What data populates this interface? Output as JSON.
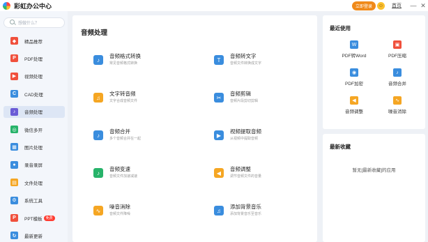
{
  "titlebar": {
    "app_title": "彩虹办公中心",
    "login_label": "立即登录",
    "home_label": "首页",
    "minimize": "—",
    "close": "✕"
  },
  "sidebar": {
    "search_placeholder": "想做什么？",
    "items": [
      {
        "label": "精品推荐",
        "icon": "gift-icon",
        "color": "#f0503c",
        "active": false
      },
      {
        "label": "PDF处理",
        "icon": "pdf-icon",
        "color": "#f0503c",
        "active": false
      },
      {
        "label": "视频处理",
        "icon": "video-icon",
        "color": "#f0503c",
        "active": false
      },
      {
        "label": "CAD处理",
        "icon": "cad-icon",
        "color": "#3a8dde",
        "active": false
      },
      {
        "label": "音频处理",
        "icon": "music-icon",
        "color": "#6a5bd6",
        "active": true
      },
      {
        "label": "微信多开",
        "icon": "wechat-icon",
        "color": "#27b36a",
        "active": false
      },
      {
        "label": "图片处理",
        "icon": "image-icon",
        "color": "#3a8dde",
        "active": false
      },
      {
        "label": "录音录屏",
        "icon": "microphone-icon",
        "color": "#3a8dde",
        "active": false
      },
      {
        "label": "文件处理",
        "icon": "folder-icon",
        "color": "#f5a623",
        "active": false
      },
      {
        "label": "系统工具",
        "icon": "system-tools-icon",
        "color": "#3a8dde",
        "active": false
      },
      {
        "label": "PPT模板",
        "icon": "ppt-icon",
        "color": "#f0503c",
        "active": false,
        "badge": "免费"
      },
      {
        "label": "最新更新",
        "icon": "update-icon",
        "color": "#3a8dde",
        "active": false
      }
    ]
  },
  "main": {
    "title": "音频处理",
    "tools": [
      {
        "name": "音频格式转换",
        "desc": "常见音频格式转换",
        "icon": "audio-convert-icon",
        "color": "#3a8dde",
        "glyph": "♪"
      },
      {
        "name": "音频转文字",
        "desc": "音频文件转换成文字",
        "icon": "audio-to-text-icon",
        "color": "#3a8dde",
        "glyph": "T"
      },
      {
        "name": "文字转音频",
        "desc": "文字合成音频文件",
        "icon": "text-to-audio-icon",
        "color": "#f5a623",
        "glyph": "♫"
      },
      {
        "name": "音频剪辑",
        "desc": "音频片段剪切剪辑",
        "icon": "audio-cut-icon",
        "color": "#3a8dde",
        "glyph": "✂"
      },
      {
        "name": "音频合并",
        "desc": "多个音频合并在一起",
        "icon": "audio-merge-icon",
        "color": "#3a8dde",
        "glyph": "♪"
      },
      {
        "name": "视频提取音频",
        "desc": "从视频中提取音频",
        "icon": "video-extract-audio-icon",
        "color": "#3a8dde",
        "glyph": "▶"
      },
      {
        "name": "音频变速",
        "desc": "音频文件加速减速",
        "icon": "audio-speed-icon",
        "color": "#27b36a",
        "glyph": "♪"
      },
      {
        "name": "音频调整",
        "desc": "调节音频文件的音量",
        "icon": "audio-volume-icon",
        "color": "#f5a623",
        "glyph": "◀"
      },
      {
        "name": "噪音消除",
        "desc": "音频文件降噪",
        "icon": "noise-removal-icon",
        "color": "#f5a623",
        "glyph": "∿"
      },
      {
        "name": "添加背景音乐",
        "desc": "添加背景音乐至音乐",
        "icon": "add-bgm-icon",
        "color": "#3a8dde",
        "glyph": "♫"
      }
    ]
  },
  "recent": {
    "title": "最近使用",
    "items": [
      {
        "label": "PDF转Word",
        "icon": "pdf-to-word-icon",
        "color": "#3a8dde",
        "glyph": "W"
      },
      {
        "label": "PDF压缩",
        "icon": "pdf-compress-icon",
        "color": "#f0503c",
        "glyph": "▣"
      },
      {
        "label": "PDF加密",
        "icon": "pdf-encrypt-icon",
        "color": "#3a8dde",
        "glyph": "◉"
      },
      {
        "label": "音频合并",
        "icon": "audio-merge-icon",
        "color": "#3a8dde",
        "glyph": "♪"
      },
      {
        "label": "音频调整",
        "icon": "audio-volume-icon",
        "color": "#f5a623",
        "glyph": "◀"
      },
      {
        "label": "噪音消除",
        "icon": "noise-removal-icon",
        "color": "#f5a623",
        "glyph": "∿"
      }
    ]
  },
  "favorites": {
    "title": "最新收藏",
    "empty_text": "暂无[最新收藏]的应用"
  }
}
